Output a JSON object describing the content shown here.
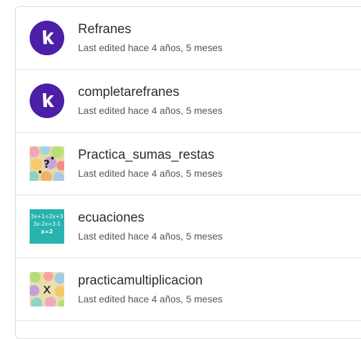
{
  "items": [
    {
      "title": "Refranes",
      "subtitle": "Last edited hace 4 años, 5 meses",
      "thumb": "kahoot-k-logo"
    },
    {
      "title": "completarefranes",
      "subtitle": "Last edited hace 4 años, 5 meses",
      "thumb": "kahoot-k-logo"
    },
    {
      "title": "Practica_sumas_restas",
      "subtitle": "Last edited hace 4 años, 5 meses",
      "thumb": "colorful-dots-math-image"
    },
    {
      "title": "ecuaciones",
      "subtitle": "Last edited hace 4 años, 5 meses",
      "thumb": "equations-image",
      "thumb_text": [
        "3x+1=2x+3",
        "3x-2x=3-1",
        "x=2"
      ]
    },
    {
      "title": "practicamultiplicacion",
      "subtitle": "Last edited hace 4 años, 5 meses",
      "thumb": "colorful-dots-multiplication-image",
      "thumb_text": [
        "x"
      ]
    }
  ],
  "colors": {
    "kahoot_purple": "#4b1fa8",
    "teal": "#29b3b0"
  }
}
